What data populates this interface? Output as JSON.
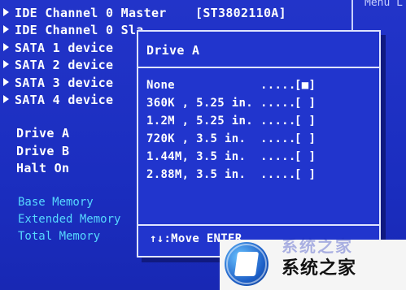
{
  "main": {
    "items": [
      {
        "label": "IDE Channel 0 Master"
      },
      {
        "label": "IDE Channel 0 Sla"
      },
      {
        "label": "SATA 1 device"
      },
      {
        "label": "SATA 2 device"
      },
      {
        "label": "SATA 3 device"
      },
      {
        "label": "SATA 4 device"
      }
    ],
    "master_value": "[ST3802110A]",
    "drive_items": [
      "Drive A",
      "Drive B",
      "Halt On"
    ],
    "memory_labels": [
      "Base Memory",
      "Extended Memory",
      "Total Memory"
    ]
  },
  "right_panel": {
    "header": "Menu L"
  },
  "popup": {
    "title": "Drive A",
    "options": [
      {
        "label": "None",
        "dots": ".....",
        "marker": "[■]"
      },
      {
        "label": "360K , 5.25 in.",
        "dots": ".....",
        "marker": "[ ]"
      },
      {
        "label": "1.2M  , 5.25 in.",
        "dots": ".....",
        "marker": "[ ]"
      },
      {
        "label": "720K , 3.5 in.",
        "dots": ".....",
        "marker": "[ ]"
      },
      {
        "label": "1.44M, 3.5 in.",
        "dots": ".....",
        "marker": "[ ]"
      },
      {
        "label": "2.88M, 3.5 in.",
        "dots": ".....",
        "marker": "[ ]"
      }
    ],
    "help": "↑↓:Move ENTER"
  },
  "watermark": {
    "brand": "系统之家",
    "ghost": "系统之家"
  },
  "colors": {
    "background": "#1a2fc4",
    "text": "#ffffff",
    "cyan": "#56d8ff",
    "border": "#dfe4ff"
  }
}
